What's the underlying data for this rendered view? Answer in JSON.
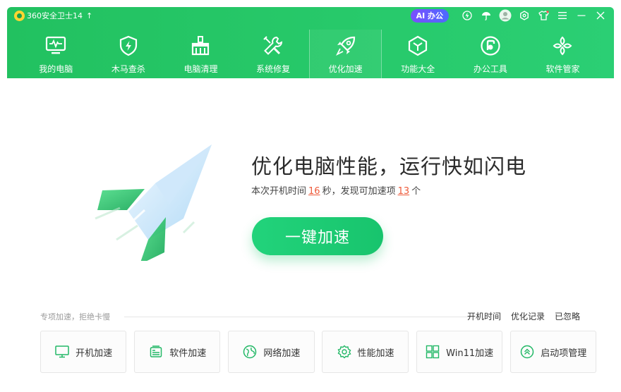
{
  "app": {
    "title": "360安全卫士14",
    "up_arrow": "↑",
    "ai_badge": "AI 办公"
  },
  "colors": {
    "header_green": "#27c96a",
    "accent_green": "#22d37b",
    "highlight_red": "#ee5a3a",
    "ai_purple": "#7a4dff"
  },
  "titlebar_icons": [
    "lightning-icon",
    "umbrella-icon",
    "user-avatar-icon",
    "settings-icon",
    "skin-icon",
    "menu-icon",
    "minimize-icon",
    "close-icon"
  ],
  "nav": {
    "items": [
      {
        "label": "我的电脑",
        "icon": "monitor-icon"
      },
      {
        "label": "木马查杀",
        "icon": "shield-lightning-icon"
      },
      {
        "label": "电脑清理",
        "icon": "broom-icon"
      },
      {
        "label": "系统修复",
        "icon": "wrench-icon"
      },
      {
        "label": "优化加速",
        "icon": "rocket-icon"
      },
      {
        "label": "功能大全",
        "icon": "cube-icon"
      },
      {
        "label": "办公工具",
        "icon": "office-icon"
      },
      {
        "label": "软件管家",
        "icon": "apps-icon"
      }
    ],
    "active_index": 4
  },
  "hero": {
    "title": "优化电脑性能，运行快如闪电",
    "sub_prefix": "本次开机时间",
    "boot_seconds": "16",
    "sub_mid": "秒，发现可加速项",
    "items_count": "13",
    "sub_suffix": "个",
    "cta_label": "一键加速"
  },
  "section": {
    "label": "专项加速，拒绝卡慢",
    "links": [
      "开机时间",
      "优化记录",
      "已忽略"
    ],
    "cards": [
      {
        "label": "开机加速",
        "icon": "monitor-icon"
      },
      {
        "label": "软件加速",
        "icon": "software-icon"
      },
      {
        "label": "网络加速",
        "icon": "globe-icon"
      },
      {
        "label": "性能加速",
        "icon": "gear-icon"
      },
      {
        "label": "Win11加速",
        "icon": "windows-icon"
      },
      {
        "label": "启动项管理",
        "icon": "chevrons-up-icon"
      }
    ]
  }
}
